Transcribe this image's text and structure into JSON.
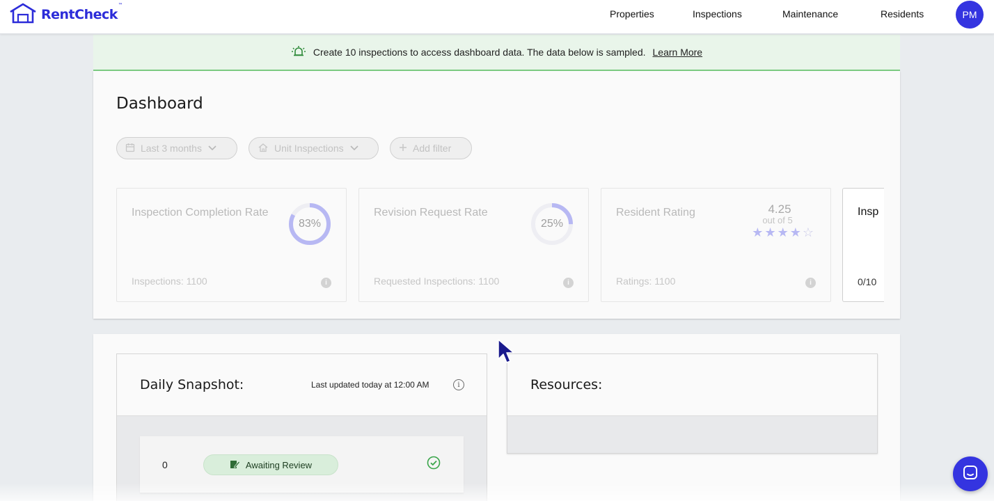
{
  "app": {
    "logo_text": "RentCheck",
    "logo_tm": "™"
  },
  "nav": {
    "properties": "Properties",
    "inspections": "Inspections",
    "maintenance": "Maintenance",
    "residents": "Residents",
    "avatar_initials": "PM"
  },
  "banner": {
    "text": "Create 10 inspections to access dashboard data. The data below is sampled.",
    "link": "Learn More"
  },
  "dashboard": {
    "title": "Dashboard",
    "filters": {
      "date_range": "Last 3 months",
      "inspection_type": "Unit Inspections",
      "add_filter": "Add filter"
    },
    "metrics": {
      "completion": {
        "title": "Inspection Completion Rate",
        "value": 83,
        "value_label": "83%",
        "footer": "Inspections: 1100"
      },
      "revision": {
        "title": "Revision Request Rate",
        "value": 25,
        "value_label": "25%",
        "footer": "Requested Inspections: 1100"
      },
      "rating": {
        "title": "Resident Rating",
        "value": "4.25",
        "sub": "out of 5",
        "stars_filled": 4,
        "stars_total": 5,
        "footer": "Ratings: 1100"
      },
      "fourth": {
        "title": "Insp",
        "footer": "0/10"
      }
    }
  },
  "snapshot": {
    "title": "Daily Snapshot:",
    "updated": "Last updated today at 12:00 AM",
    "info": "i",
    "rows": [
      {
        "count": "0",
        "label": "Awaiting Review"
      }
    ]
  },
  "resources": {
    "title": "Resources:"
  },
  "colors": {
    "brand": "#3434e0",
    "ring": "#b7b8f3",
    "banner_bg": "#e9f5ea",
    "banner_border": "#7ccb82",
    "badge_bg": "#d9eedb",
    "success": "#3aa54a"
  }
}
